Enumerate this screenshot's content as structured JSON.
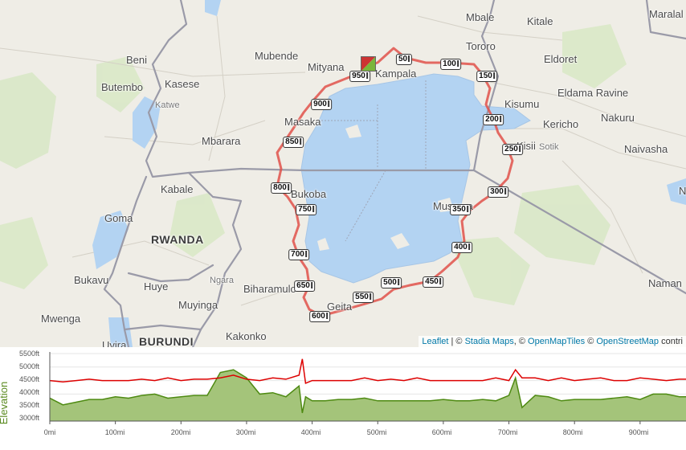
{
  "map": {
    "places": [
      {
        "name": "Mbale",
        "kind": "city"
      },
      {
        "name": "Kitale",
        "kind": "city"
      },
      {
        "name": "Maralal",
        "kind": "city"
      },
      {
        "name": "Beni",
        "kind": "city"
      },
      {
        "name": "Mubende",
        "kind": "city"
      },
      {
        "name": "Mityana",
        "kind": "city"
      },
      {
        "name": "Kampala",
        "kind": "city"
      },
      {
        "name": "Tororo",
        "kind": "city"
      },
      {
        "name": "Eldoret",
        "kind": "city"
      },
      {
        "name": "Butembo",
        "kind": "city"
      },
      {
        "name": "Kasese",
        "kind": "city"
      },
      {
        "name": "Katwe",
        "kind": "small"
      },
      {
        "name": "Eldama Ravine",
        "kind": "city"
      },
      {
        "name": "Kisumu",
        "kind": "city"
      },
      {
        "name": "Masaka",
        "kind": "city"
      },
      {
        "name": "Kericho",
        "kind": "city"
      },
      {
        "name": "Nakuru",
        "kind": "city"
      },
      {
        "name": "Mbarara",
        "kind": "city"
      },
      {
        "name": "Kisii",
        "kind": "city"
      },
      {
        "name": "Sotik",
        "kind": "small"
      },
      {
        "name": "Naivasha",
        "kind": "city"
      },
      {
        "name": "Kabale",
        "kind": "city"
      },
      {
        "name": "Bukoba",
        "kind": "city"
      },
      {
        "name": "N",
        "kind": "city"
      },
      {
        "name": "Goma",
        "kind": "city"
      },
      {
        "name": "Musoma",
        "kind": "city"
      },
      {
        "name": "RWANDA",
        "kind": "country"
      },
      {
        "name": "Bukavu",
        "kind": "city"
      },
      {
        "name": "Huye",
        "kind": "city"
      },
      {
        "name": "Ngara",
        "kind": "small"
      },
      {
        "name": "Biharamulo",
        "kind": "city"
      },
      {
        "name": "Naman",
        "kind": "city"
      },
      {
        "name": "Muyinga",
        "kind": "city"
      },
      {
        "name": "Geita",
        "kind": "city"
      },
      {
        "name": "Mwenga",
        "kind": "city"
      },
      {
        "name": "Kakonko",
        "kind": "city"
      },
      {
        "name": "Uvira",
        "kind": "city"
      },
      {
        "name": "BURUNDI",
        "kind": "country"
      }
    ],
    "mile_markers": [
      "50",
      "100",
      "150",
      "200",
      "250",
      "300",
      "350",
      "400",
      "450",
      "500",
      "550",
      "600",
      "650",
      "700",
      "750",
      "800",
      "850",
      "900",
      "950"
    ],
    "attribution": {
      "leaflet": "Leaflet",
      "sep1": " | © ",
      "stadia": "Stadia Maps",
      "sep2": ", © ",
      "omt": "OpenMapTiles",
      "sep3": " © ",
      "osm": "OpenStreetMap",
      "tail": " contri"
    },
    "colors": {
      "water": "#b3d3f2",
      "route": "#e0514a",
      "border": "#9a9aa8",
      "land": "#efede6"
    }
  },
  "elevation": {
    "axis_title": "Elevation",
    "y_ticks": [
      "5500ft",
      "5000ft",
      "4500ft",
      "4000ft",
      "3500ft",
      "3000ft"
    ],
    "x_ticks": [
      "0mi",
      "100mi",
      "200mi",
      "300mi",
      "400mi",
      "500mi",
      "600mi",
      "700mi",
      "800mi",
      "900mi"
    ],
    "colors": {
      "fill": "#a4c47a",
      "terrain_line": "#4e8a12",
      "cap_line": "#dd0000"
    }
  },
  "chart_data": {
    "type": "area",
    "xlabel": "",
    "ylabel": "Elevation",
    "xlim": [
      0,
      970
    ],
    "ylim": [
      3000,
      5500
    ],
    "x_unit": "mi",
    "y_unit": "ft",
    "series": [
      {
        "x": [
          0,
          20,
          40,
          60,
          80,
          100,
          120,
          140,
          160,
          180,
          200,
          220,
          240,
          260,
          280,
          300,
          320,
          340,
          360,
          380,
          385,
          390,
          400,
          420,
          440,
          460,
          480,
          500,
          520,
          540,
          560,
          580,
          600,
          620,
          640,
          660,
          680,
          700,
          710,
          720,
          740,
          760,
          780,
          800,
          820,
          840,
          860,
          880,
          900,
          920,
          940,
          960,
          970
        ],
        "values": [
          3850,
          3600,
          3700,
          3800,
          3800,
          3900,
          3850,
          3950,
          4000,
          3850,
          3900,
          3950,
          3950,
          4800,
          4900,
          4600,
          4000,
          4050,
          3900,
          4300,
          3300,
          3900,
          3750,
          3750,
          3800,
          3800,
          3850,
          3750,
          3750,
          3750,
          3750,
          3750,
          3800,
          3750,
          3750,
          3800,
          3750,
          3950,
          4600,
          3500,
          3950,
          3900,
          3750,
          3800,
          3800,
          3800,
          3850,
          3900,
          3800,
          4000,
          4000,
          3900,
          3900
        ]
      },
      {
        "x": [
          0,
          20,
          40,
          60,
          80,
          100,
          120,
          140,
          160,
          180,
          200,
          220,
          240,
          260,
          280,
          300,
          320,
          340,
          360,
          380,
          385,
          390,
          400,
          420,
          440,
          460,
          480,
          500,
          520,
          540,
          560,
          580,
          600,
          620,
          640,
          660,
          680,
          700,
          710,
          720,
          740,
          760,
          780,
          800,
          820,
          840,
          860,
          880,
          900,
          920,
          940,
          960,
          970
        ],
        "values": [
          4500,
          4450,
          4500,
          4550,
          4500,
          4500,
          4500,
          4550,
          4500,
          4600,
          4500,
          4550,
          4550,
          4600,
          4700,
          4550,
          4500,
          4600,
          4550,
          4700,
          5300,
          4400,
          4500,
          4500,
          4500,
          4500,
          4600,
          4500,
          4550,
          4500,
          4600,
          4500,
          4500,
          4500,
          4500,
          4500,
          4600,
          4500,
          4900,
          4600,
          4600,
          4500,
          4600,
          4500,
          4550,
          4600,
          4500,
          4500,
          4600,
          4550,
          4500,
          4550,
          4550
        ]
      }
    ]
  }
}
